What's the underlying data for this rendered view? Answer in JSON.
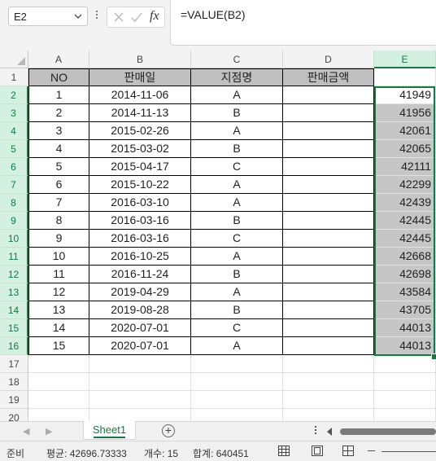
{
  "formula_bar": {
    "name_box": "E2",
    "fx_label": "fx",
    "formula": "=VALUE(B2)"
  },
  "columns": [
    "A",
    "B",
    "C",
    "D",
    "E"
  ],
  "row_numbers": [
    "1",
    "2",
    "3",
    "4",
    "5",
    "6",
    "7",
    "8",
    "9",
    "10",
    "11",
    "12",
    "13",
    "14",
    "15",
    "16",
    "17",
    "18",
    "19",
    "20"
  ],
  "table": {
    "headers": [
      "NO",
      "판매일",
      "지점명",
      "판매금액"
    ],
    "rows": [
      {
        "no": "1",
        "date": "2014-11-06",
        "branch": "A",
        "amount": "",
        "e": "41949"
      },
      {
        "no": "2",
        "date": "2014-11-13",
        "branch": "B",
        "amount": "",
        "e": "41956"
      },
      {
        "no": "3",
        "date": "2015-02-26",
        "branch": "A",
        "amount": "",
        "e": "42061"
      },
      {
        "no": "4",
        "date": "2015-03-02",
        "branch": "B",
        "amount": "",
        "e": "42065"
      },
      {
        "no": "5",
        "date": "2015-04-17",
        "branch": "C",
        "amount": "",
        "e": "42111"
      },
      {
        "no": "6",
        "date": "2015-10-22",
        "branch": "A",
        "amount": "",
        "e": "42299"
      },
      {
        "no": "7",
        "date": "2016-03-10",
        "branch": "A",
        "amount": "",
        "e": "42439"
      },
      {
        "no": "8",
        "date": "2016-03-16",
        "branch": "B",
        "amount": "",
        "e": "42445"
      },
      {
        "no": "9",
        "date": "2016-03-16",
        "branch": "C",
        "amount": "",
        "e": "42445"
      },
      {
        "no": "10",
        "date": "2016-10-25",
        "branch": "A",
        "amount": "",
        "e": "42668"
      },
      {
        "no": "11",
        "date": "2016-11-24",
        "branch": "B",
        "amount": "",
        "e": "42698"
      },
      {
        "no": "12",
        "date": "2019-04-29",
        "branch": "A",
        "amount": "",
        "e": "43584"
      },
      {
        "no": "13",
        "date": "2019-08-28",
        "branch": "B",
        "amount": "",
        "e": "43705"
      },
      {
        "no": "14",
        "date": "2020-07-01",
        "branch": "C",
        "amount": "",
        "e": "44013"
      },
      {
        "no": "15",
        "date": "2020-07-01",
        "branch": "A",
        "amount": "",
        "e": "44013"
      }
    ]
  },
  "sheet_tabs": [
    "Sheet1"
  ],
  "status_bar": {
    "ready": "준비",
    "average": "평균: 42696.73333",
    "count": "개수: 15",
    "sum": "합계: 640451"
  },
  "colors": {
    "accent": "#107c41",
    "header_fill": "#bfbfbf",
    "selection_fill": "#c6c6c6"
  }
}
